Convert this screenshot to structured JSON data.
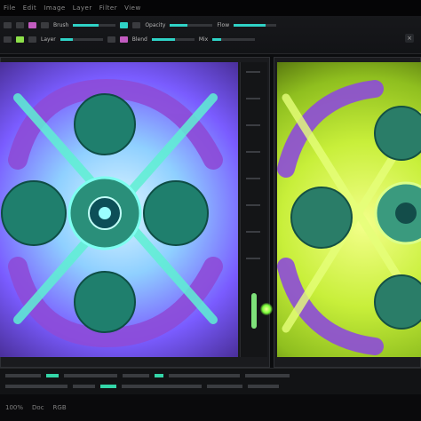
{
  "app": {
    "menubar": [
      "File",
      "Edit",
      "Image",
      "Layer",
      "Filter",
      "View"
    ]
  },
  "toolbar": {
    "row1_labels": [
      "Brush",
      "Opacity",
      "Flow"
    ],
    "row2_labels": [
      "Layer",
      "Blend",
      "Mix"
    ]
  },
  "window_controls": {
    "close_label": "×"
  },
  "status": {
    "zoom_label": "100%",
    "items": [
      "Doc",
      "RGB"
    ]
  },
  "colors": {
    "accent_cyan": "#2fd2c6",
    "accent_pink": "#c25bc0",
    "accent_green": "#8de04a",
    "left_canvas_teal": "#1f7f6d",
    "left_canvas_purple": "#8d4bd8",
    "right_canvas_lime": "#c8ef3a",
    "right_canvas_teal": "#2a7d68"
  },
  "icons": {
    "window_close": "close-icon",
    "menu": "menu-icon",
    "status_glow": "status-glow-icon"
  }
}
